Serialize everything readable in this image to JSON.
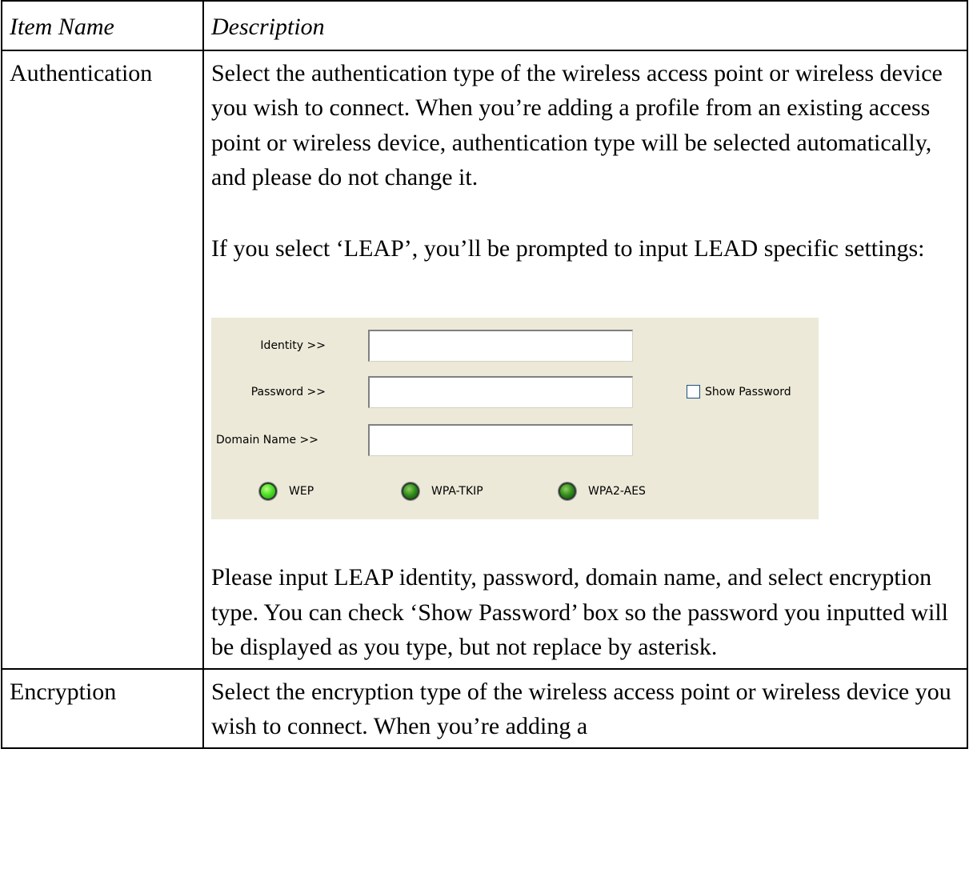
{
  "table": {
    "header": {
      "item_name": "Item Name",
      "description": "Description"
    },
    "rows": [
      {
        "item": "Authentication",
        "paragraphs": [
          "Select the authentication type of the wireless access point or wireless device you wish to connect. When you’re adding a profile from an existing access point or wireless device, authentication type will be selected automatically, and please do not change it.",
          "If you select ‘LEAP’, you’ll be prompted to input LEAD specific settings:",
          "Please input LEAP identity, password, domain name, and select encryption type. You can check ‘Show Password’ box so the password you inputted will be displayed as you type, but not replace by asterisk."
        ]
      },
      {
        "item": "Encryption",
        "paragraphs": [
          "Select the encryption type of the wireless access point or wireless device you wish to connect. When you’re adding a"
        ]
      }
    ]
  },
  "leap_panel": {
    "identity_label": "Identity >>",
    "identity_value": "",
    "password_label": "Password >>",
    "password_value": "",
    "domain_label": "Domain Name >>",
    "domain_value": "",
    "show_password_label": "Show Password",
    "show_password_checked": false,
    "encryption_options": [
      {
        "label": "WEP",
        "selected": true
      },
      {
        "label": "WPA-TKIP",
        "selected": false
      },
      {
        "label": "WPA2-AES",
        "selected": false
      }
    ],
    "colors": {
      "panel_background": "#ece9d8",
      "led_on": "#4ee02a",
      "led_off": "#2f8a1c"
    }
  }
}
